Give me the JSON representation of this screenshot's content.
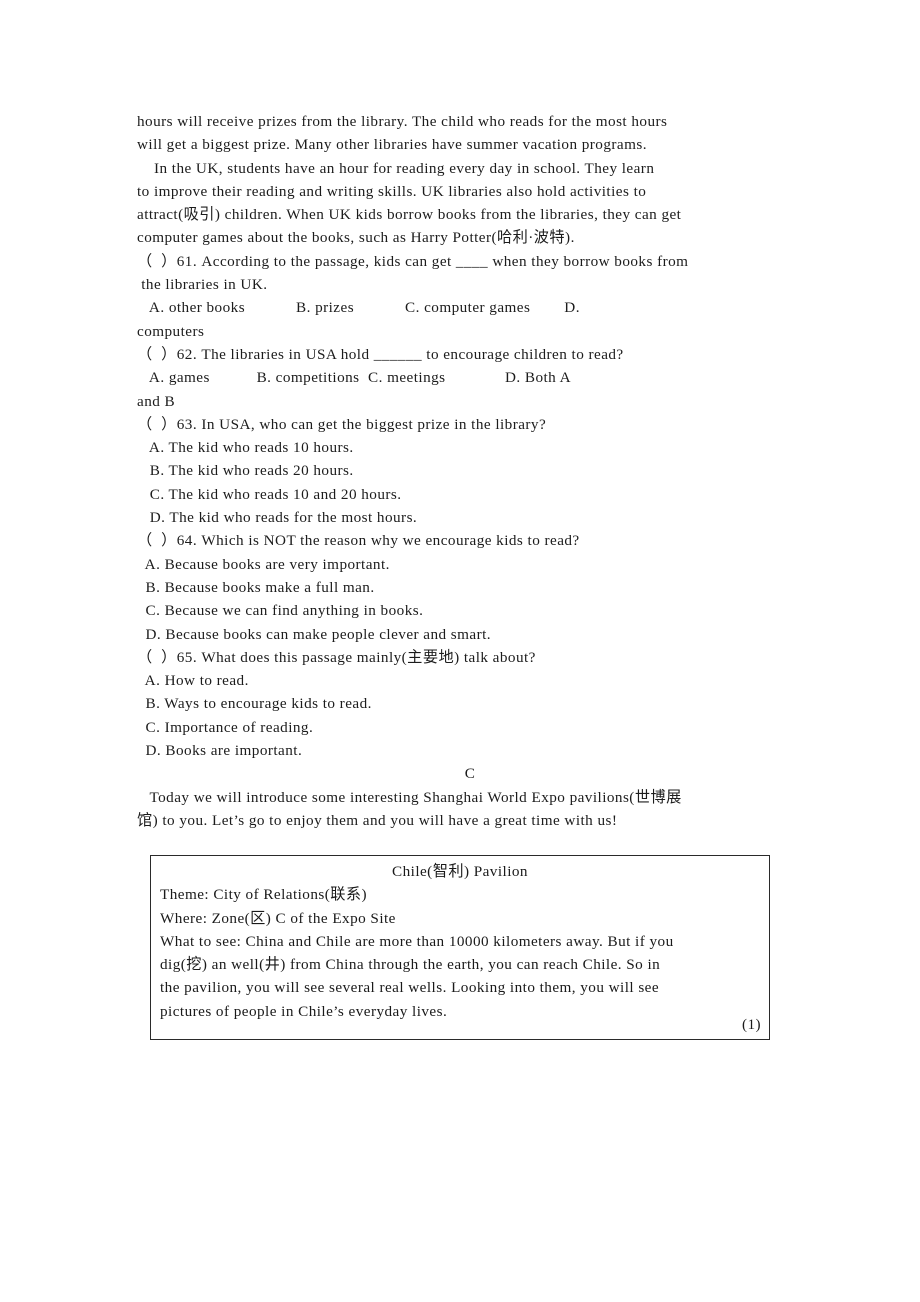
{
  "document": {
    "type": "english-exam-reading-comprehension",
    "page_number_label": "(1)"
  },
  "passage_b_tail": {
    "lines": [
      "hours will receive prizes from the library. The child who reads for the most hours",
      "will get a biggest prize. Many other libraries have summer vacation programs.",
      "    In the UK, students have an hour for reading every day in school. They learn",
      "to improve their reading and writing skills. UK libraries also hold activities to",
      "attract(吸引) children. When UK kids borrow books from the libraries, they can get",
      "computer games about the books, such as Harry Potter(哈利·波特)."
    ]
  },
  "questions": [
    {
      "number": "61",
      "stem_lines": [
        "（  ）61. According to the passage, kids can get ____ when they borrow books from",
        " the libraries in UK."
      ],
      "option_lines": [
        "   A. other books            B. prizes            C. computer games        D.",
        "computers"
      ]
    },
    {
      "number": "62",
      "stem_lines": [
        "（  ）62. The libraries in USA hold ______ to encourage children to read?"
      ],
      "option_lines": [
        "   A. games           B. competitions  C. meetings              D. Both A",
        "and B"
      ]
    },
    {
      "number": "63",
      "stem_lines": [
        "（  ）63. In USA, who can get the biggest prize in the library?"
      ],
      "option_lines": [
        "   A. The kid who reads 10 hours.",
        "   B. The kid who reads 20 hours.",
        "   C. The kid who reads 10 and 20 hours.",
        "   D. The kid who reads for the most hours."
      ]
    },
    {
      "number": "64",
      "stem_lines": [
        "（  ）64. Which is NOT the reason why we encourage kids to read?"
      ],
      "option_lines": [
        "  A. Because books are very important.",
        "  B. Because books make a full man.",
        "  C. Because we can find anything in books.",
        "  D. Because books can make people clever and smart."
      ]
    },
    {
      "number": "65",
      "stem_lines": [
        "（  ）65. What does this passage mainly(主要地) talk about?"
      ],
      "option_lines": [
        "  A. How to read.",
        "  B. Ways to encourage kids to read.",
        "  C. Importance of reading.",
        "  D. Books are important."
      ]
    }
  ],
  "section_c": {
    "heading": "C",
    "intro_lines": [
      "   Today we will introduce some interesting Shanghai World Expo pavilions(世博展",
      "馆) to you. Let’s go to enjoy them and you will have a great time with us!"
    ]
  },
  "pavilion_box": {
    "title": "Chile(智利) Pavilion",
    "body_lines": [
      "Theme: City of Relations(联系)",
      "Where: Zone(区) C of the Expo Site",
      "What to see: China and Chile are more than 10000 kilometers away. But if you",
      "dig(挖) an well(井) from China through the earth, you can reach Chile. So in",
      "the pavilion, you will see several real wells. Looking into them, you will see",
      "pictures of people in Chile’s everyday lives."
    ],
    "page_marker": "(1)"
  },
  "colors": {
    "text": "#1c1c1c",
    "border": "#2a2a2a",
    "background": "#ffffff"
  }
}
